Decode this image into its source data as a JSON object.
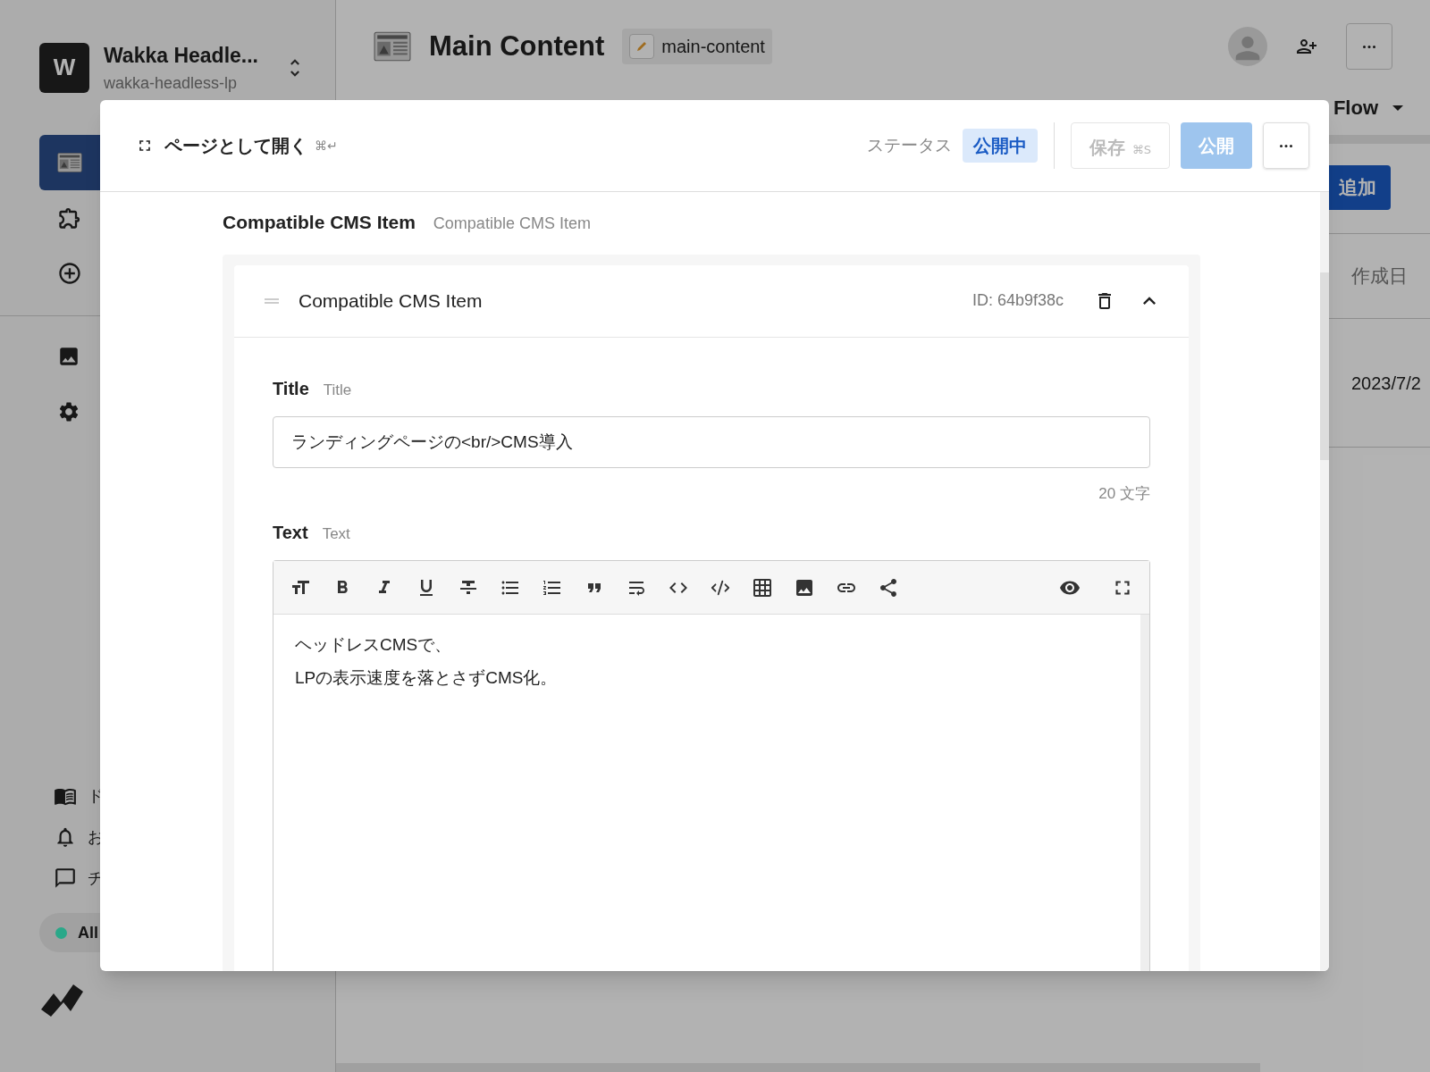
{
  "workspace": {
    "name": "Wakka Headle...",
    "slug": "wakka-headless-lp",
    "logo_letter": "W"
  },
  "sidebar": {
    "nav_items": [
      {
        "selected": true
      },
      {
        "selected": false
      },
      {
        "selected": false
      }
    ],
    "tool_items": [
      {
        "selected": false
      },
      {
        "selected": false
      }
    ],
    "footer_items": [
      {
        "label": "ド"
      },
      {
        "label": "お"
      },
      {
        "label": "チ"
      }
    ],
    "status_filter": {
      "label": "All",
      "color": "#2aa889"
    }
  },
  "page": {
    "title": "Main Content",
    "slug": "main-content",
    "view_label": "Flow",
    "add_button": "追加",
    "table": {
      "columns": [
        "作成日"
      ],
      "rows": [
        [
          "2023/7/2"
        ]
      ]
    }
  },
  "modal": {
    "open_as_page": "ページとして開く",
    "open_shortcut": "⌘↵",
    "status_label": "ステータス",
    "status": "公開中",
    "save": {
      "label": "保存",
      "shortcut": "⌘S",
      "disabled": true
    },
    "publish": {
      "label": "公開",
      "disabled": true
    },
    "section": {
      "title": "Compatible CMS Item",
      "subtitle": "Compatible CMS Item"
    },
    "item": {
      "title": "Compatible CMS Item",
      "id": "ID: 64b9f38c",
      "expanded": true,
      "fields": [
        {
          "kind": "text",
          "label": "Title",
          "sublabel": "Title",
          "value": "ランディングページの<br/>CMS導入",
          "count": "20 文字"
        },
        {
          "kind": "richtext",
          "label": "Text",
          "sublabel": "Text",
          "lines": [
            "ヘッドレスCMSで、",
            "LPの表示速度を落とさずCMS化。"
          ]
        }
      ]
    }
  }
}
